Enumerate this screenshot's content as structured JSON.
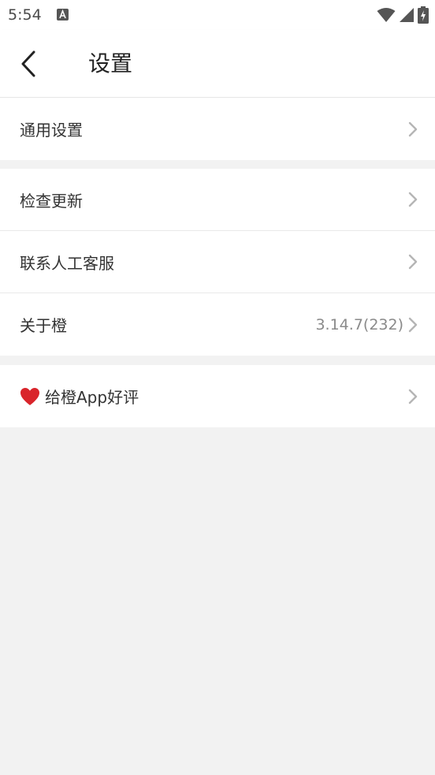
{
  "status_bar": {
    "time": "5:54",
    "icons": [
      "a-notification-icon",
      "wifi-icon",
      "signal-icon",
      "battery-charging-icon"
    ]
  },
  "toolbar": {
    "title": "设置",
    "back_icon": "back-arrow-icon"
  },
  "groups": [
    {
      "items": [
        {
          "label": "通用设置",
          "value": ""
        }
      ]
    },
    {
      "items": [
        {
          "label": "检查更新",
          "value": ""
        },
        {
          "label": "联系人工客服",
          "value": ""
        },
        {
          "label": "关于橙",
          "value": "3.14.7(232)"
        }
      ]
    },
    {
      "items": [
        {
          "label": "给橙App好评",
          "value": "",
          "icon": "heart-icon"
        }
      ]
    }
  ],
  "colors": {
    "background": "#f2f2f2",
    "surface": "#ffffff",
    "heart": "#d9252b",
    "chevron": "#b5b5b5"
  }
}
